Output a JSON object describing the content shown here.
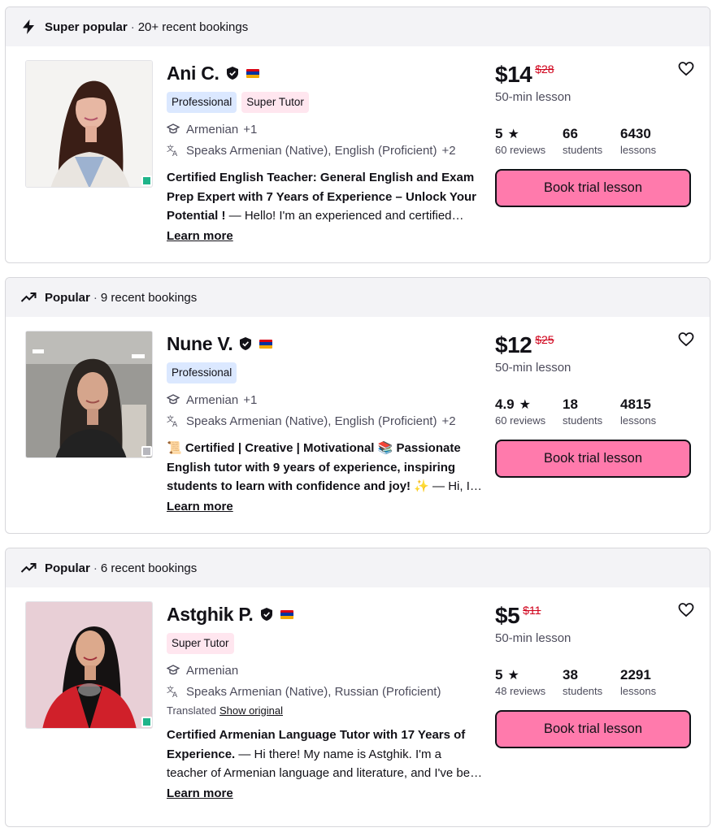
{
  "cards": [
    {
      "badge": "Super popular",
      "badge_icon": "lightning-icon",
      "recent": "20+ recent bookings",
      "name": "Ani C.",
      "tags": [
        "Professional",
        "Super Tutor"
      ],
      "subject": "Armenian",
      "subject_extra": "+1",
      "speaks": "Speaks Armenian (Native), English (Proficient)",
      "speaks_extra": "+2",
      "headline": "Certified English Teacher: General English and Exam Prep Expert with 7 Years of Experience – Unlock Your Potential !",
      "intro": " — Hello! I'm an experienced and certified English teacher",
      "learn_more": "Learn more",
      "price": "$14",
      "old_price": "$28",
      "lesson_length": "50-min lesson",
      "rating": "5",
      "reviews": "60 reviews",
      "students": "66",
      "students_label": "students",
      "lessons": "6430",
      "lessons_label": "lessons",
      "book": "Book trial lesson",
      "online_color": "#1fb48a"
    },
    {
      "badge": "Popular",
      "badge_icon": "trending-up-icon",
      "recent": "9 recent bookings",
      "name": "Nune V.",
      "tags": [
        "Professional"
      ],
      "subject": "Armenian",
      "subject_extra": "+1",
      "speaks": "Speaks Armenian (Native), English (Proficient)",
      "speaks_extra": "+2",
      "headline": "📜 Certified | Creative | Motivational 📚 Passionate English tutor with 9 years of experience, inspiring students to learn with confidence and joy! ✨",
      "intro": " — Hi, I'm Nune",
      "learn_more": "Learn more",
      "price": "$12",
      "old_price": "$25",
      "lesson_length": "50-min lesson",
      "rating": "4.9",
      "reviews": "60 reviews",
      "students": "18",
      "students_label": "students",
      "lessons": "4815",
      "lessons_label": "lessons",
      "book": "Book trial lesson",
      "online_color": "#b7b7bd"
    },
    {
      "badge": "Popular",
      "badge_icon": "trending-up-icon",
      "recent": "6 recent bookings",
      "name": "Astghik P.",
      "tags": [
        "Super Tutor"
      ],
      "subject": "Armenian",
      "subject_extra": "",
      "speaks": "Speaks Armenian (Native), Russian (Proficient)",
      "speaks_extra": "",
      "translated": "Translated",
      "show_original": "Show original",
      "headline": "Certified Armenian Language Tutor with 17 Years of Experience.",
      "intro": " — Hi there! My name is Astghik. I'm a teacher of Armenian language and literature, and I've been teaching",
      "learn_more": "Learn more",
      "price": "$5",
      "old_price": "$11",
      "lesson_length": "50-min lesson",
      "rating": "5",
      "reviews": "48 reviews",
      "students": "38",
      "students_label": "students",
      "lessons": "2291",
      "lessons_label": "lessons",
      "book": "Book trial lesson",
      "online_color": "#1fb48a"
    }
  ],
  "colors": {
    "book_button": "#ff7aac",
    "old_price": "#d0021b",
    "tag_professional": "#dbe8ff",
    "tag_super_tutor": "#ffe6ef",
    "header_bg": "#f3f3f6"
  }
}
